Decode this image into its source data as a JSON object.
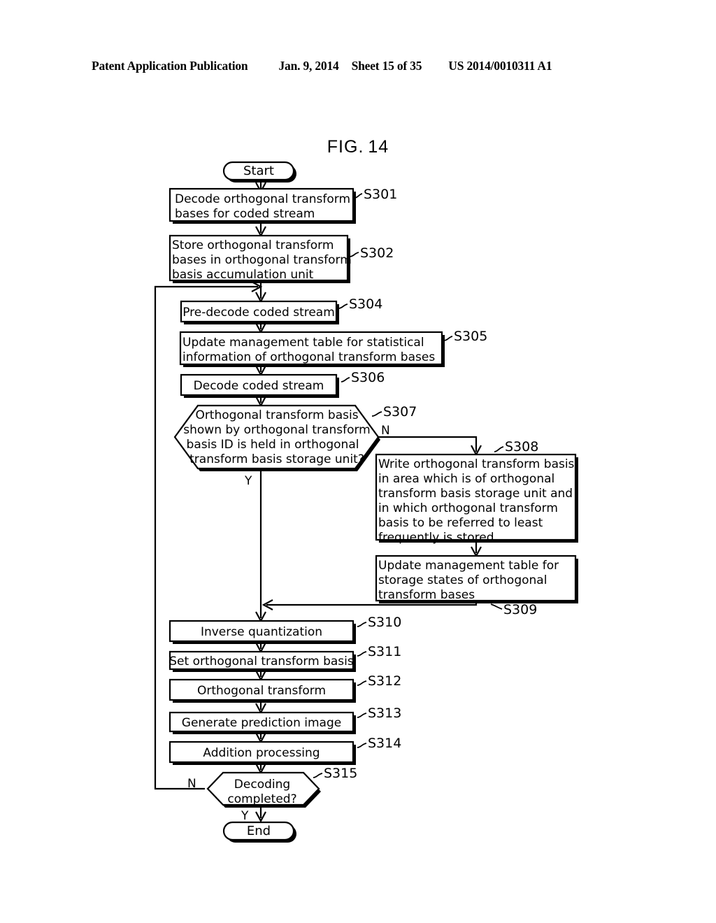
{
  "header": {
    "publication": "Patent Application Publication",
    "date": "Jan. 9, 2014",
    "sheet": "Sheet 15 of 35",
    "patent_number": "US 2014/0010311 A1"
  },
  "figure": {
    "label": "FIG.",
    "number": "14"
  },
  "flowchart": {
    "terminals": {
      "start": "Start",
      "end": "End"
    },
    "branch_labels": {
      "s307_yes": "Y",
      "s307_no": "N",
      "s315_yes": "Y",
      "s315_no": "N"
    },
    "nodes": [
      {
        "id": "S301",
        "shape": "process",
        "lines": [
          "Decode orthogonal transform",
          "bases for coded stream"
        ]
      },
      {
        "id": "S302",
        "shape": "process",
        "lines": [
          "Store orthogonal transform",
          "bases in orthogonal transform",
          "basis accumulation unit"
        ]
      },
      {
        "id": "S304",
        "shape": "process",
        "lines": [
          "Pre-decode coded stream"
        ]
      },
      {
        "id": "S305",
        "shape": "process",
        "lines": [
          "Update management table for statistical",
          "information of orthogonal transform bases"
        ]
      },
      {
        "id": "S306",
        "shape": "process",
        "lines": [
          "Decode coded stream"
        ]
      },
      {
        "id": "S307",
        "shape": "decision",
        "lines": [
          "Orthogonal transform basis",
          "shown by orthogonal transform",
          "basis ID is held in orthogonal",
          "transform basis storage unit?"
        ]
      },
      {
        "id": "S308",
        "shape": "process",
        "lines": [
          "Write orthogonal transform basis",
          "in area which is of orthogonal",
          "transform basis storage unit and",
          "in which orthogonal transform",
          "basis to be referred to least",
          "frequently is stored"
        ]
      },
      {
        "id": "S309",
        "shape": "process",
        "lines": [
          "Update management table for",
          "storage states of orthogonal",
          "transform bases"
        ]
      },
      {
        "id": "S310",
        "shape": "process",
        "lines": [
          "Inverse quantization"
        ]
      },
      {
        "id": "S311",
        "shape": "process",
        "lines": [
          "Set orthogonal transform basis"
        ]
      },
      {
        "id": "S312",
        "shape": "process",
        "lines": [
          "Orthogonal transform"
        ]
      },
      {
        "id": "S313",
        "shape": "process",
        "lines": [
          "Generate prediction image"
        ]
      },
      {
        "id": "S314",
        "shape": "process",
        "lines": [
          "Addition processing"
        ]
      },
      {
        "id": "S315",
        "shape": "decision",
        "lines": [
          "Decoding",
          "completed?"
        ]
      }
    ]
  }
}
